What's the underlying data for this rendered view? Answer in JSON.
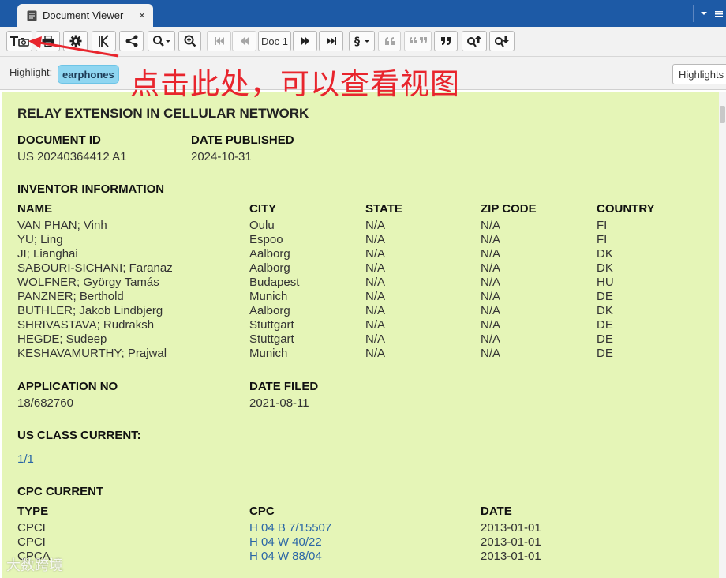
{
  "window": {
    "tab_title": "Document Viewer",
    "tab_close": "×"
  },
  "toolbar": {
    "doc_select": "Doc 1"
  },
  "highlight": {
    "label": "Highlight:",
    "term": "earphones",
    "button": "Highlights"
  },
  "annotation": "点击此处，可以查看视图",
  "watermark": "大数跨境",
  "document": {
    "title": "RELAY EXTENSION IN CELLULAR NETWORK",
    "doc_id_label": "DOCUMENT ID",
    "doc_id": "US 20240364412 A1",
    "date_published_label": "DATE PUBLISHED",
    "date_published": "2024-10-31",
    "inventor_heading": "INVENTOR INFORMATION",
    "inventor_columns": [
      "NAME",
      "CITY",
      "STATE",
      "ZIP CODE",
      "COUNTRY"
    ],
    "inventors": [
      [
        "VAN PHAN; Vinh",
        "Oulu",
        "N/A",
        "N/A",
        "FI"
      ],
      [
        "YU; Ling",
        "Espoo",
        "N/A",
        "N/A",
        "FI"
      ],
      [
        "JI; Lianghai",
        "Aalborg",
        "N/A",
        "N/A",
        "DK"
      ],
      [
        "SABOURI-SICHANI; Faranaz",
        "Aalborg",
        "N/A",
        "N/A",
        "DK"
      ],
      [
        "WOLFNER; György Tamás",
        "Budapest",
        "N/A",
        "N/A",
        "HU"
      ],
      [
        "PANZNER; Berthold",
        "Munich",
        "N/A",
        "N/A",
        "DE"
      ],
      [
        "BUTHLER; Jakob Lindbjerg",
        "Aalborg",
        "N/A",
        "N/A",
        "DK"
      ],
      [
        "SHRIVASTAVA; Rudraksh",
        "Stuttgart",
        "N/A",
        "N/A",
        "DE"
      ],
      [
        "HEGDE; Sudeep",
        "Stuttgart",
        "N/A",
        "N/A",
        "DE"
      ],
      [
        "KESHAVAMURTHY; Prajwal",
        "Munich",
        "N/A",
        "N/A",
        "DE"
      ]
    ],
    "app_no_label": "APPLICATION NO",
    "app_no": "18/682760",
    "date_filed_label": "DATE FILED",
    "date_filed": "2021-08-11",
    "us_class_label": "US CLASS CURRENT:",
    "us_class": "1/1",
    "cpc_heading": "CPC CURRENT",
    "cpc_columns": [
      "TYPE",
      "CPC",
      "DATE"
    ],
    "cpc": [
      [
        "CPCI",
        "H 04 B 7/15507",
        "2013-01-01"
      ],
      [
        "CPCI",
        "H 04 W 40/22",
        "2013-01-01"
      ],
      [
        "CPCA",
        "H 04 W 88/04",
        "2013-01-01"
      ]
    ]
  }
}
